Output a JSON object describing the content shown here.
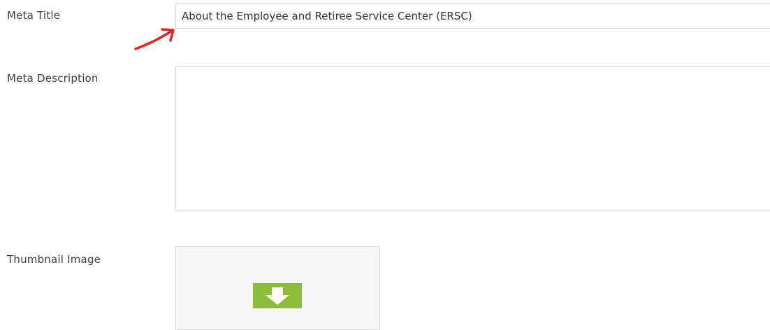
{
  "form": {
    "meta_title": {
      "label": "Meta Title",
      "value": "About the Employee and Retiree Service Center (ERSC)"
    },
    "meta_description": {
      "label": "Meta Description",
      "value": ""
    },
    "thumbnail": {
      "label": "Thumbnail Image",
      "icon": "download-arrow-icon",
      "icon_color": "#8dbb3a"
    }
  },
  "annotation": {
    "arrow_color": "#d92b2b"
  }
}
